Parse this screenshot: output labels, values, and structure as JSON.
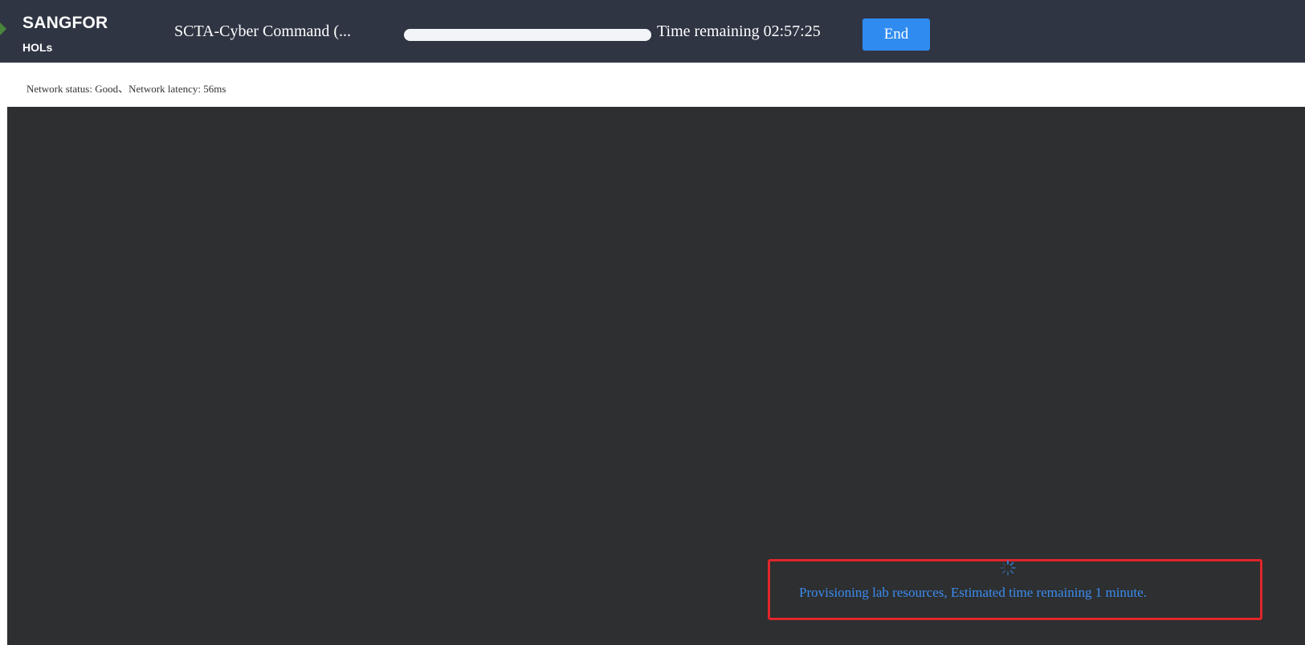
{
  "header": {
    "logo_title": "SANGFOR",
    "logo_subtitle": "HOLs",
    "lab_title": "SCTA-Cyber Command (...",
    "progress": 1.0,
    "time_remaining": "Time remaining 02:57:25",
    "end_label": "End"
  },
  "status": {
    "network_text": "Network status: Good、Network latency: 56ms"
  },
  "console": {
    "provision_message": "Provisioning lab resources, Estimated time remaining 1 minute.",
    "spinner_icon": "loading-spinner-icon"
  },
  "colors": {
    "header_bg": "#2f3543",
    "accent": "#2f8bf0",
    "console_bg": "#2d2f30",
    "highlight_border": "#e1262b",
    "message_text": "#3b8cf0"
  }
}
